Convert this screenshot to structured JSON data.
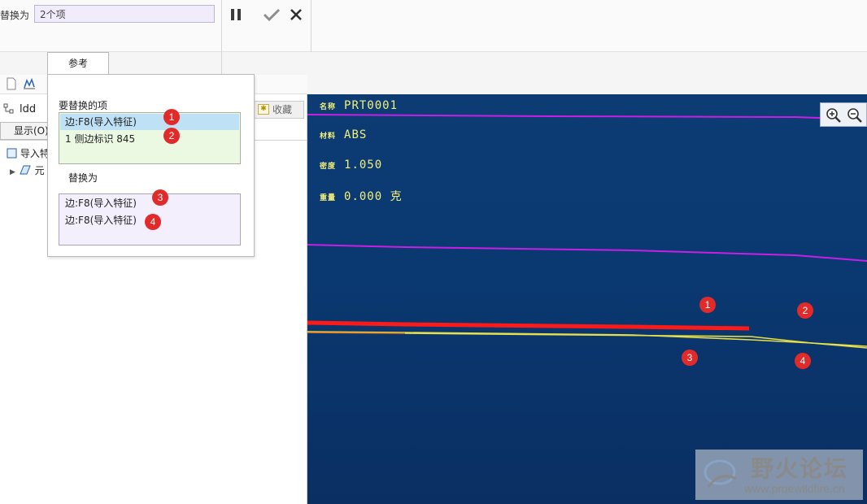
{
  "dashboard": {
    "replace_label": "替换为",
    "replace_value": "2个项",
    "tab_reference": "参考"
  },
  "reference_panel": {
    "items_label": "要替换的项",
    "items": [
      "边:F8(导入特征)",
      "1 侧边标识 845"
    ],
    "with_label": "替换为",
    "with_items": [
      "边:F8(导入特征)",
      "边:F8(导入特征)"
    ]
  },
  "model_tree": {
    "title": "ldd",
    "favorites_tab": "收藏",
    "show_button": "显示(O)",
    "rows": [
      "导入特",
      "元"
    ]
  },
  "graphics": {
    "params": [
      {
        "key": "名称",
        "value": "PRT0001"
      },
      {
        "key": "材料",
        "value": "ABS"
      },
      {
        "key": "密度",
        "value": "1.050"
      },
      {
        "key": "重量",
        "value": "0.000 克"
      }
    ],
    "colors": {
      "magenta_edge": "#c81fe6",
      "selected_edge": "#ff1a1a",
      "yellow_edge": "#e8e04a",
      "orange_edge": "#e67a1e"
    }
  },
  "badges": [
    "1",
    "2",
    "3",
    "4"
  ],
  "watermark": {
    "title": "野火论坛",
    "url": "www.proewildfire.cn"
  },
  "icons": [
    "pause-icon",
    "check-icon",
    "close-icon",
    "zoom-in-icon",
    "zoom-out-icon",
    "new-icon",
    "tree-icon",
    "star-icon"
  ]
}
